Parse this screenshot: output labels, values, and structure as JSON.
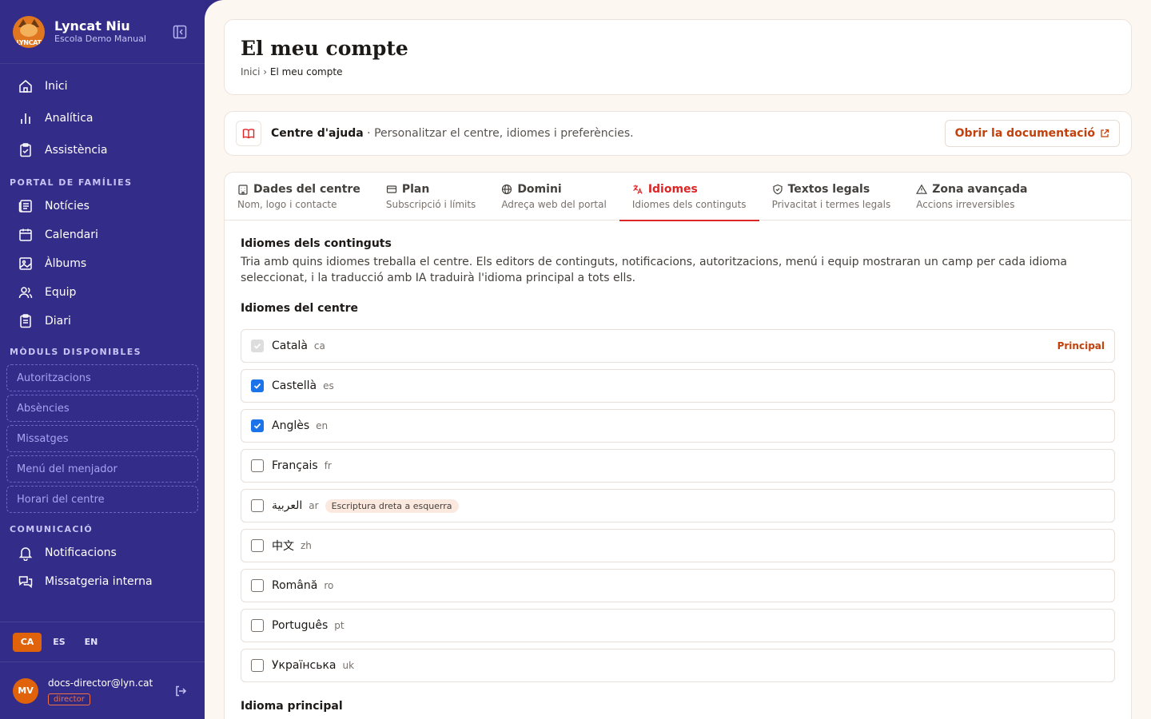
{
  "brand": {
    "name": "Lyncat Niu",
    "subtitle": "Escola Demo Manual",
    "logo_text": "LYNCAT"
  },
  "nav_primary": [
    {
      "label": "Inici",
      "icon": "home-icon"
    },
    {
      "label": "Analítica",
      "icon": "chart-icon"
    },
    {
      "label": "Assistència",
      "icon": "clipboard-check-icon"
    }
  ],
  "portal_section": "PORTAL DE FAMÍLIES",
  "portal_items": [
    {
      "label": "Notícies",
      "icon": "newspaper-icon"
    },
    {
      "label": "Calendari",
      "icon": "calendar-icon"
    },
    {
      "label": "Àlbums",
      "icon": "image-icon"
    },
    {
      "label": "Equip",
      "icon": "users-icon"
    },
    {
      "label": "Diari",
      "icon": "clipboard-icon"
    }
  ],
  "modules_section": "MÒDULS DISPONIBLES",
  "modules": [
    "Autoritzacions",
    "Absències",
    "Missatges",
    "Menú del menjador",
    "Horari del centre"
  ],
  "comm_section": "COMUNICACIÓ",
  "comm_items": [
    {
      "label": "Notificacions",
      "icon": "bell-icon"
    },
    {
      "label": "Missatgeria interna",
      "icon": "messages-icon"
    }
  ],
  "languages_switch": [
    "CA",
    "ES",
    "EN"
  ],
  "active_language": "CA",
  "user": {
    "initials": "MV",
    "email": "docs-director@lyn.cat",
    "role": "director"
  },
  "page": {
    "title": "El meu compte",
    "breadcrumb_home": "Inici",
    "breadcrumb_sep": "›",
    "breadcrumb_current": "El meu compte"
  },
  "help": {
    "title": "Centre d'ajuda",
    "separator": " · ",
    "text": "Personalitzar el centre, idiomes i preferències.",
    "button": "Obrir la documentació"
  },
  "tabs": [
    {
      "title": "Dades del centre",
      "sub": "Nom, logo i contacte",
      "icon": "building-icon",
      "active": false
    },
    {
      "title": "Plan",
      "sub": "Subscripció i límits",
      "icon": "card-icon",
      "active": false
    },
    {
      "title": "Domini",
      "sub": "Adreça web del portal",
      "icon": "globe-icon",
      "active": false
    },
    {
      "title": "Idiomes",
      "sub": "Idiomes dels continguts",
      "icon": "translate-icon",
      "active": true
    },
    {
      "title": "Textos legals",
      "sub": "Privacitat i termes legals",
      "icon": "shield-icon",
      "active": false
    },
    {
      "title": "Zona avançada",
      "sub": "Accions irreversibles",
      "icon": "warning-icon",
      "active": false
    }
  ],
  "section": {
    "title": "Idiomes dels continguts",
    "description": "Tria amb quins idiomes treballa el centre. Els editors de continguts, notificacions, autoritzacions, menú i equip mostraran un camp per cada idioma seleccionat, i la traducció amb IA traduirà l'idioma principal a tots ells.",
    "languages_title": "Idiomes del centre",
    "principal_label": "Principal",
    "main_language_title": "Idioma principal"
  },
  "center_languages": [
    {
      "name": "Català",
      "code": "ca",
      "checked": true,
      "disabled": true,
      "principal": true
    },
    {
      "name": "Castellà",
      "code": "es",
      "checked": true
    },
    {
      "name": "Anglès",
      "code": "en",
      "checked": true
    },
    {
      "name": "Français",
      "code": "fr",
      "checked": false
    },
    {
      "name": "العربية",
      "code": "ar",
      "checked": false,
      "badge": "Escriptura dreta a esquerra"
    },
    {
      "name": "中文",
      "code": "zh",
      "checked": false
    },
    {
      "name": "Română",
      "code": "ro",
      "checked": false
    },
    {
      "name": "Português",
      "code": "pt",
      "checked": false
    },
    {
      "name": "Українська",
      "code": "uk",
      "checked": false
    }
  ],
  "colors": {
    "sidebar": "#332c88",
    "accent": "#dc2626",
    "orange": "#c2410c",
    "checkbox": "#1a73e8"
  }
}
